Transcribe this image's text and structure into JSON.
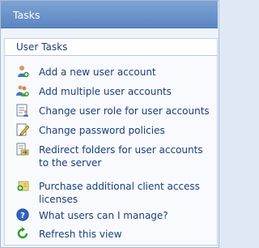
{
  "panel": {
    "title": "Tasks"
  },
  "section": {
    "title": "User Tasks"
  },
  "tasks": [
    {
      "label": "Add a new user account",
      "icon": "add-user-icon"
    },
    {
      "label": "Add multiple user accounts",
      "icon": "add-users-icon"
    },
    {
      "label": "Change user role for user accounts",
      "icon": "user-role-icon"
    },
    {
      "label": "Change password policies",
      "icon": "pencil-icon"
    },
    {
      "label": "Redirect folders for user accounts to the server",
      "icon": "redirect-folder-icon"
    },
    {
      "label": "Purchase additional client access licenses",
      "icon": "licenses-icon"
    },
    {
      "label": "What users can I manage?",
      "icon": "help-icon"
    },
    {
      "label": "Refresh this view",
      "icon": "refresh-icon"
    }
  ],
  "colors": {
    "header": "#5b86c2",
    "background": "#dfe9f5",
    "link": "#1b3e7a"
  }
}
